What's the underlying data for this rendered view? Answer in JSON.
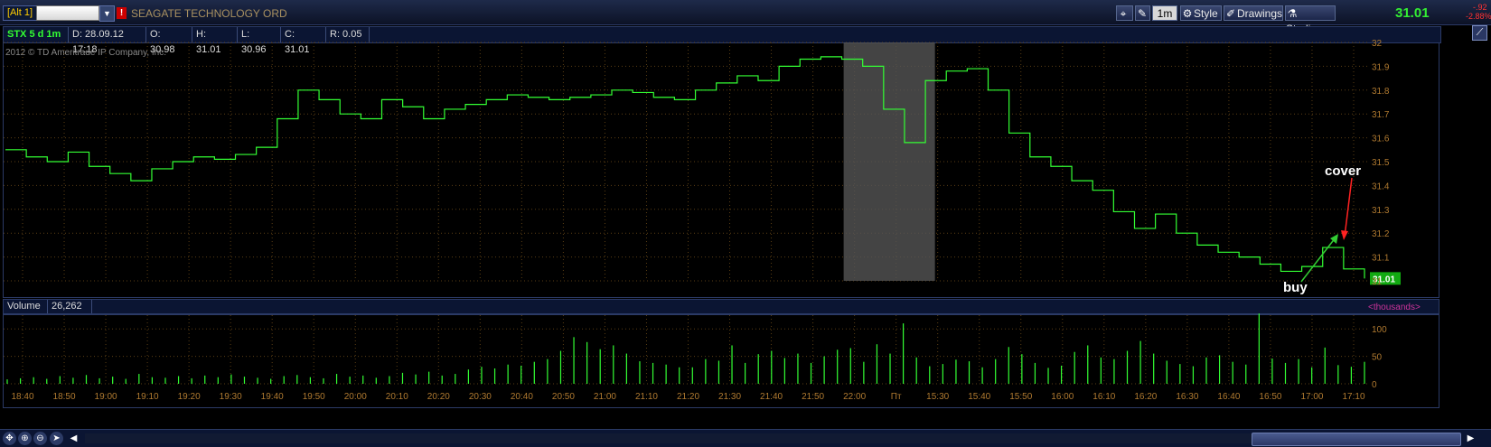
{
  "topbar": {
    "alt_label": "[Alt 1]",
    "company_name": "SEAGATE TECHNOLOGY ORD",
    "period_button": "1m",
    "style_label": "Style",
    "drawings_label": "Drawings",
    "studies_label": "Studies",
    "last_price": "31.01",
    "change_abs": "-.92",
    "change_pct": "-2.88%"
  },
  "infobar": {
    "symbol": "STX 5 d 1m",
    "date": "D: 28.09.12 17:18",
    "open": "O: 30.98",
    "high": "H: 31.01",
    "low": "L: 30.96",
    "close": "C: 31.01",
    "range": "R: 0.05"
  },
  "copyright": "2012 © TD Ameritrade IP Company, Inc.",
  "volume_header": {
    "label": "Volume",
    "value": "26,262",
    "units": "<thousands>"
  },
  "annotations": {
    "cover": "cover",
    "buy": "buy"
  },
  "colors": {
    "price_line": "#33ff33",
    "volume_bar": "#33ff33",
    "grid": "#5a3e14",
    "axis_text": "#b07a30",
    "session_shade": "#555555",
    "cover_arrow": "#ff2222",
    "buy_arrow": "#33cc33"
  },
  "chart_data": [
    {
      "type": "line",
      "title": "STX 5 d 1m",
      "ylim": [
        31.0,
        32.0
      ],
      "y_ticks": [
        "31",
        "31.1",
        "31.2",
        "31.3",
        "31.4",
        "31.5",
        "31.6",
        "31.7",
        "31.8",
        "31.9",
        "32"
      ],
      "x_tick_labels": [
        "18:40",
        "18:50",
        "19:00",
        "19:10",
        "19:20",
        "19:30",
        "19:40",
        "19:50",
        "20:00",
        "20:10",
        "20:20",
        "20:30",
        "20:40",
        "20:50",
        "21:00",
        "21:10",
        "21:20",
        "21:30",
        "21:40",
        "21:50",
        "22:00",
        "Пт",
        "15:30",
        "15:40",
        "15:50",
        "16:00",
        "16:10",
        "16:20",
        "16:30",
        "16:40",
        "16:50",
        "17:00",
        "17:10"
      ],
      "last_value_label": "31.01",
      "grid": true,
      "series": [
        {
          "values": [
            31.55,
            31.52,
            31.5,
            31.54,
            31.48,
            31.45,
            31.42,
            31.47,
            31.5,
            31.52,
            31.51,
            31.53,
            31.56,
            31.68,
            31.8,
            31.76,
            31.7,
            31.68,
            31.76,
            31.73,
            31.68,
            31.72,
            31.74,
            31.76,
            31.78,
            31.77,
            31.76,
            31.77,
            31.78,
            31.8,
            31.79,
            31.77,
            31.76,
            31.8,
            31.83,
            31.86,
            31.84,
            31.9,
            31.93,
            31.94,
            31.93,
            31.9,
            31.72,
            31.58,
            31.84,
            31.88,
            31.89,
            31.8,
            31.62,
            31.52,
            31.48,
            31.42,
            31.38,
            31.29,
            31.22,
            31.28,
            31.2,
            31.15,
            31.12,
            31.1,
            31.07,
            31.04,
            31.06,
            31.14,
            31.05,
            31.01
          ]
        }
      ],
      "session_break": {
        "from": "22:00",
        "to": "Пт"
      }
    },
    {
      "type": "bar",
      "title": "Volume",
      "ylim": [
        0,
        125
      ],
      "y_ticks": [
        "0",
        "50",
        "100"
      ],
      "units": "<thousands>",
      "values": [
        8,
        10,
        12,
        9,
        14,
        11,
        16,
        10,
        13,
        9,
        18,
        12,
        11,
        14,
        10,
        15,
        12,
        17,
        13,
        11,
        9,
        14,
        16,
        12,
        10,
        18,
        13,
        15,
        11,
        14,
        20,
        17,
        22,
        15,
        18,
        26,
        31,
        28,
        35,
        33,
        40,
        45,
        60,
        85,
        76,
        63,
        70,
        55,
        41,
        38,
        35,
        30,
        30,
        45,
        42,
        70,
        38,
        54,
        60,
        47,
        55,
        38,
        50,
        62,
        65,
        40,
        72,
        55,
        110,
        48,
        32,
        36,
        44,
        41,
        30,
        45,
        67,
        54,
        38,
        29,
        33,
        58,
        70,
        48,
        45,
        60,
        78,
        55,
        42,
        36,
        32,
        48,
        52,
        40,
        35,
        128,
        46,
        38,
        45,
        30,
        66,
        34,
        31,
        40
      ]
    }
  ]
}
